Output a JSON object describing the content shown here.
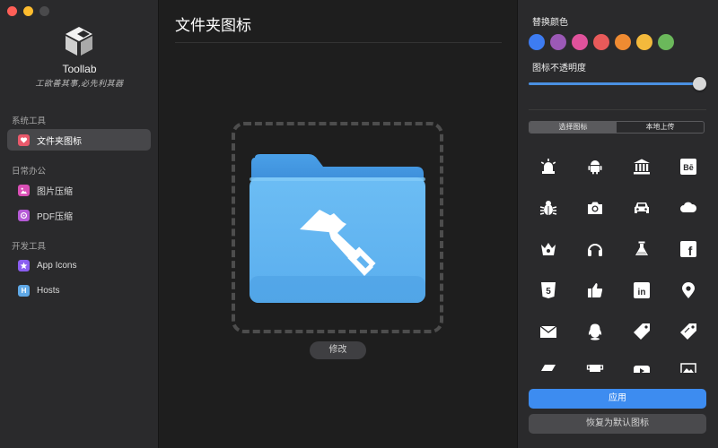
{
  "app": {
    "name": "Toollab",
    "slogan": "工欲善其事,必先利其器"
  },
  "sidebar": {
    "sections": [
      {
        "title": "系统工具",
        "items": [
          {
            "label": "文件夹图标",
            "icon": "folder-heart-icon",
            "active": true
          }
        ]
      },
      {
        "title": "日常办公",
        "items": [
          {
            "label": "图片压缩",
            "icon": "image-icon"
          },
          {
            "label": "PDF压缩",
            "icon": "pdf-icon"
          }
        ]
      },
      {
        "title": "开发工具",
        "items": [
          {
            "label": "App Icons",
            "icon": "app-star-icon"
          },
          {
            "label": "Hosts",
            "icon": "hosts-h-icon"
          }
        ]
      }
    ]
  },
  "main": {
    "title": "文件夹图标",
    "modify_label": "修改",
    "folder_color": "#5eb3f0"
  },
  "panel": {
    "color_label": "替换颜色",
    "colors": [
      "#3d7cf2",
      "#9b59b6",
      "#e0529c",
      "#e85a5a",
      "#ef8b32",
      "#f3b93c",
      "#6bb85b"
    ],
    "opacity_label": "图标不透明度",
    "opacity_value": 1.0,
    "tabs": [
      "选择图标",
      "本地上传"
    ],
    "active_tab": 0,
    "icons": [
      "alarm-light-icon",
      "android-icon",
      "bank-icon",
      "behance-icon",
      "bug-icon",
      "camera-icon",
      "car-icon",
      "cloud-icon",
      "crown-icon",
      "headphones-icon",
      "flask-icon",
      "facebook-icon",
      "html5-icon",
      "thumbs-up-icon",
      "linkedin-icon",
      "map-pin-icon",
      "mail-icon",
      "qq-icon",
      "tag-icon",
      "tag-alt-icon",
      "zoom-partial-icon",
      "mug-partial-icon",
      "youtube-partial-icon",
      "images-partial-icon"
    ],
    "behance_text": "Bē",
    "facebook_text": "f",
    "linkedin_text": "in",
    "html5_text": "5",
    "apply_label": "应用",
    "reset_label": "恢复为默认图标"
  }
}
